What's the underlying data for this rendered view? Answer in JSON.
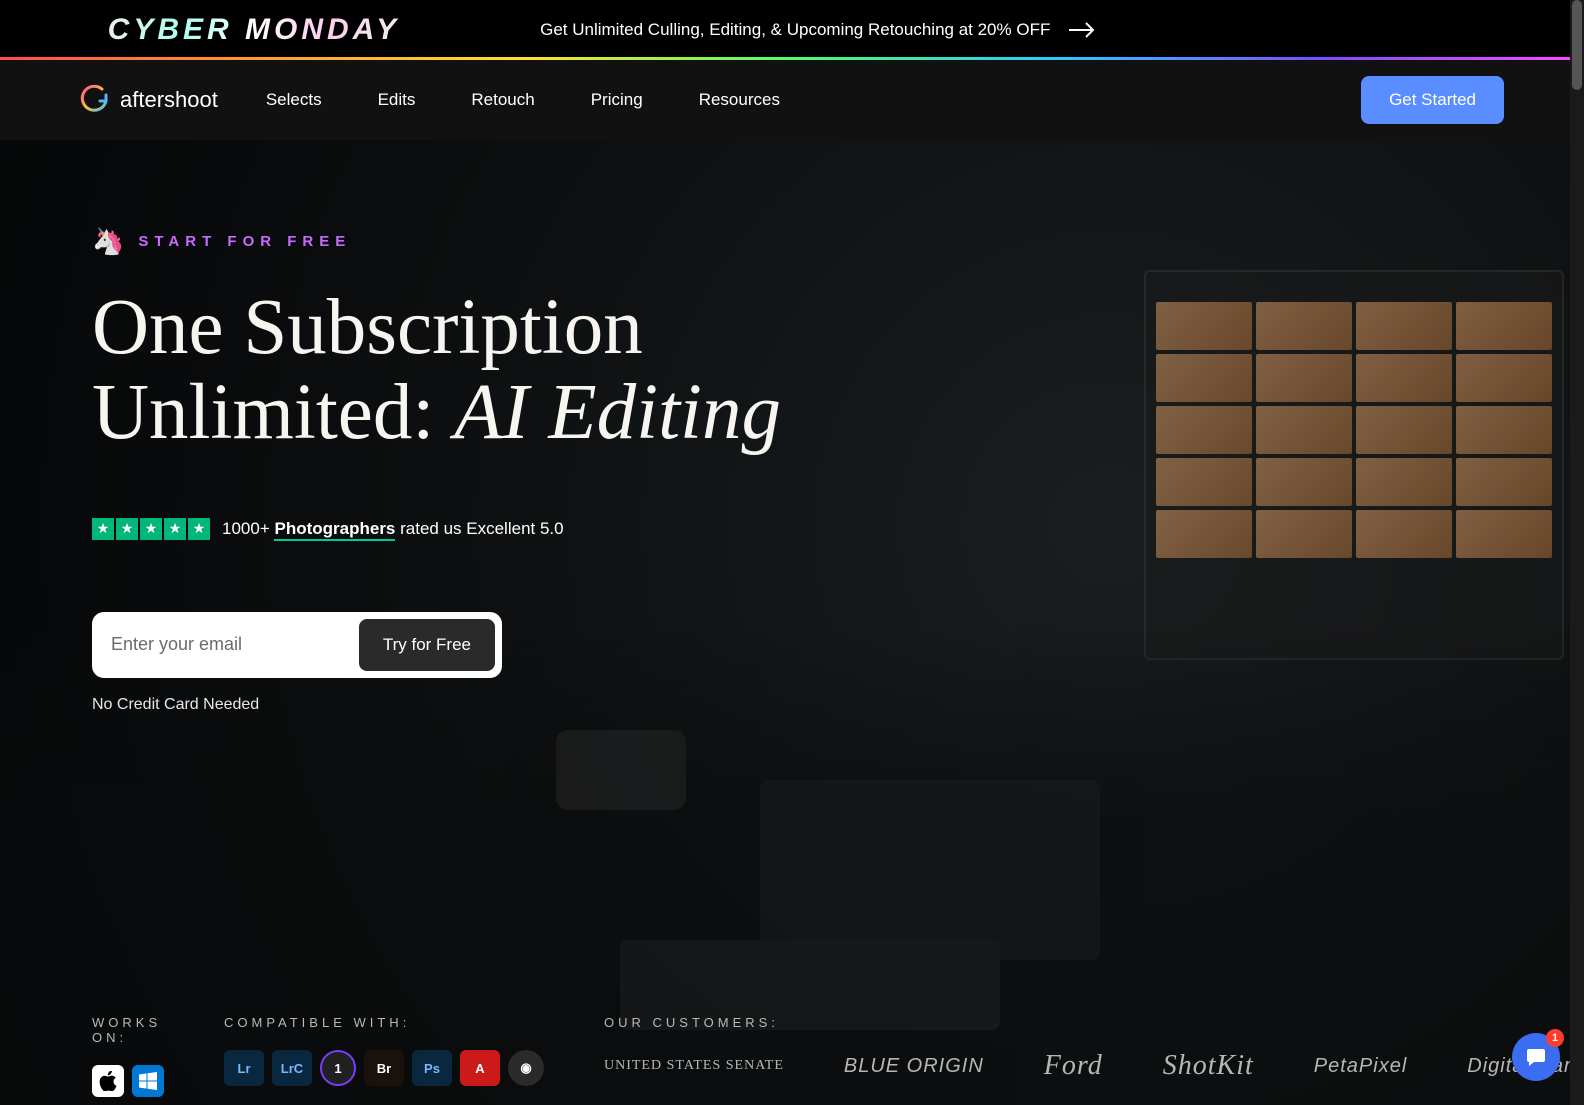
{
  "promo": {
    "headline": "CYBER MONDAY",
    "text": "Get Unlimited Culling, Editing, & Upcoming Retouching at 20% OFF"
  },
  "nav": {
    "brand": "aftershoot",
    "links": [
      "Selects",
      "Edits",
      "Retouch",
      "Pricing",
      "Resources"
    ],
    "cta": "Get Started"
  },
  "hero": {
    "tag_emoji": "🦄",
    "tag_text": "START FOR FREE",
    "headline_line1": "One Subscription",
    "headline_line2_pre": "Unlimited: ",
    "headline_line2_em": "AI Editing",
    "rating_prefix": "1000+ ",
    "rating_underline": "Photographers",
    "rating_suffix": " rated us Excellent 5.0",
    "email_placeholder": "Enter your email",
    "try_button": "Try for Free",
    "no_cc": "No Credit Card Needed"
  },
  "footer": {
    "works_on_label": "WORKS ON:",
    "compatible_label": "COMPATIBLE WITH:",
    "customers_label": "OUR CUSTOMERS:",
    "compat_icons": [
      "Lr",
      "LrC",
      "1",
      "Br",
      "Ps",
      "A",
      "◉"
    ],
    "customer_logos": [
      "UNITED STATES SENATE",
      "BLUE ORIGIN",
      "Ford",
      "ShotKit",
      "PetaPixel",
      "Digital Camera"
    ]
  },
  "chat": {
    "badge": "1"
  }
}
